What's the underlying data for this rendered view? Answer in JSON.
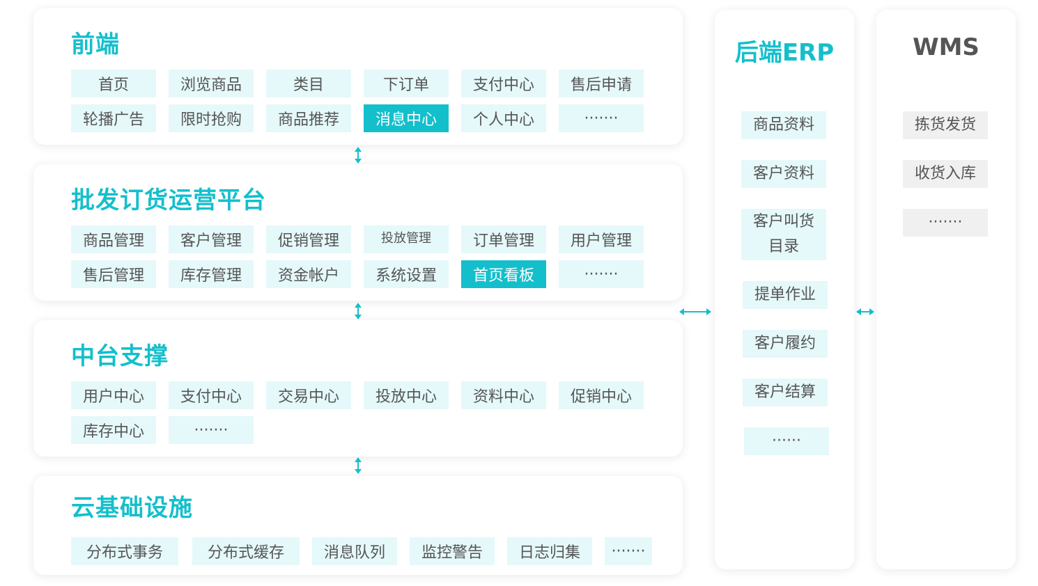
{
  "frontend": {
    "title": "前端",
    "items": [
      "首页",
      "浏览商品",
      "类目",
      "下订单",
      "支付中心",
      "售后申请",
      "轮播广告",
      "限时抢购",
      "商品推荐",
      "消息中心",
      "个人中心",
      "·······"
    ]
  },
  "platform": {
    "title": "批发订货运营平台",
    "items": [
      "商品管理",
      "客户管理",
      "促销管理",
      "投放管理",
      "订单管理",
      "用户管理",
      "售后管理",
      "库存管理",
      "资金帐户",
      "系统设置",
      "首页看板",
      "·······"
    ]
  },
  "middle": {
    "title": "中台支撑",
    "items": [
      "用户中心",
      "支付中心",
      "交易中心",
      "投放中心",
      "资料中心",
      "促销中心",
      "库存中心",
      "·······"
    ]
  },
  "infra": {
    "title": "云基础设施",
    "items": [
      "分布式事务",
      "分布式缓存",
      "消息队列",
      "监控警告",
      "日志归集",
      "·······"
    ]
  },
  "erp": {
    "title": "后端ERP",
    "items": [
      "商品资料",
      "客户资料",
      "客户叫货目录",
      "提单作业",
      "客户履约",
      "客户结算",
      "······"
    ]
  },
  "wms": {
    "title": "WMS",
    "items": [
      "拣货发货",
      "收货入库",
      "·······"
    ]
  },
  "colors": {
    "accent": "#14bfcc",
    "tag_bg": "#e5f8fa",
    "wms_tag_bg": "#f0f0f0",
    "wms_title": "#555555"
  }
}
